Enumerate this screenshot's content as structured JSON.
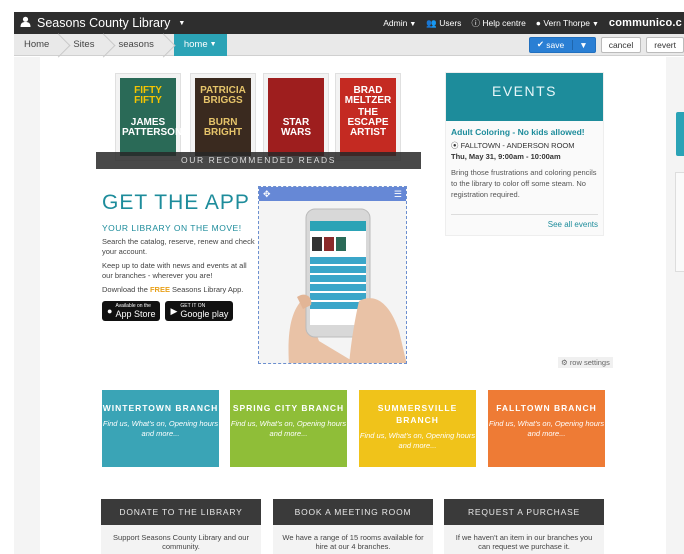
{
  "topbar": {
    "site_title": "Seasons County Library",
    "admin": "Admin",
    "users": "Users",
    "help": "Help centre",
    "user": "Vern Thorpe",
    "brand": "communico.c"
  },
  "breadcrumbs": [
    "Home",
    "Sites",
    "seasons"
  ],
  "current_page": "home",
  "actions": {
    "save": "save",
    "cancel": "cancel",
    "revert": "revert"
  },
  "books": {
    "items": [
      {
        "top": "FIFTY FIFTY",
        "bottom": "JAMES PATTERSON",
        "bg": "#2a6a57",
        "fg": "#f5c400"
      },
      {
        "top": "PATRICIA BRIGGS",
        "bottom": "BURN BRIGHT",
        "bg": "#3a2a1f",
        "fg": "#e6c46a"
      },
      {
        "top": "",
        "bottom": "STAR WARS",
        "bg": "#9e1e1e",
        "fg": "#ffffff"
      },
      {
        "top": "BRAD MELTZER",
        "bottom": "THE ESCAPE ARTIST",
        "bg": "#c42a22",
        "fg": "#ffffff"
      }
    ],
    "banner": "OUR RECOMMENDED READS"
  },
  "events": {
    "heading": "EVENTS",
    "title": "Adult Coloring - No kids allowed!",
    "location": "FALLTOWN - ANDERSON ROOM",
    "date": "Thu, May 31, 9:00am - 10:00am",
    "description": "Bring those frustrations and coloring pencils to the library to color off some steam. No registration required.",
    "see_all": "See all events"
  },
  "app": {
    "heading": "GET THE APP",
    "sub": "YOUR LIBRARY ON THE MOVE!",
    "p1": "Search the catalog, reserve, renew and check your account.",
    "p2": "Keep up to date with news and events at all our branches - wherever you are!",
    "p3_pre": "Download the ",
    "p3_free": "FREE",
    "p3_post": " Seasons Library App.",
    "appstore_small": "Available on the",
    "appstore": "App Store",
    "google_small": "GET IT ON",
    "google": "Google play"
  },
  "row_settings": "row settings",
  "branches": [
    {
      "name": "WINTERTOWN BRANCH",
      "desc": "Find us, What's on, Opening hours and more...",
      "color": "#3aa4b6"
    },
    {
      "name": "SPRING CITY BRANCH",
      "desc": "Find us, What's on, Opening hours and more...",
      "color": "#8fbe38"
    },
    {
      "name": "SUMMERSVILLE BRANCH",
      "desc": "Find us, What's on, Opening hours and more...",
      "color": "#f0c31a"
    },
    {
      "name": "FALLTOWN BRANCH",
      "desc": "Find us, What's on, Opening hours and more...",
      "color": "#ee7b35"
    }
  ],
  "bottom": [
    {
      "title": "DONATE TO THE LIBRARY",
      "text": "Support Seasons County Library and our community."
    },
    {
      "title": "BOOK A MEETING ROOM",
      "text": "We have a range of 15 rooms available for hire at our 4 branches."
    },
    {
      "title": "REQUEST A PURCHASE",
      "text": "If we haven't an item in our branches you can request we purchase it."
    }
  ]
}
